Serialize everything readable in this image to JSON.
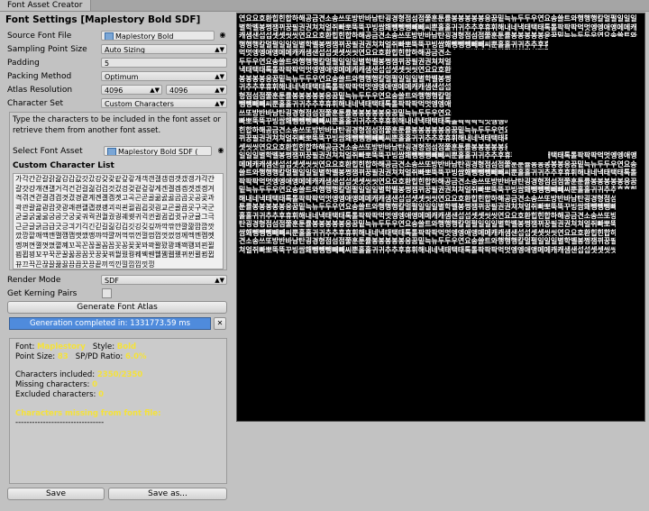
{
  "window": {
    "tab_title": "Font Asset Creator"
  },
  "settings": {
    "header": "Font Settings [Maplestory Bold SDF]",
    "source_font_file": {
      "label": "Source Font File",
      "value": "Maplestory Bold"
    },
    "sampling_point_size": {
      "label": "Sampling Point Size",
      "value": "Auto Sizing"
    },
    "padding": {
      "label": "Padding",
      "value": "5"
    },
    "packing_method": {
      "label": "Packing Method",
      "value": "Optimum"
    },
    "atlas_resolution": {
      "label": "Atlas Resolution",
      "width": "4096",
      "height": "4096"
    },
    "character_set": {
      "label": "Character Set",
      "value": "Custom Characters"
    },
    "hint": "Type the characters to be included in the font asset or retrieve them from another font asset.",
    "select_font_asset": {
      "label": "Select Font Asset",
      "value": "Maplestory Bold SDF ("
    },
    "custom_char_list_label": "Custom Character List",
    "custom_char_list": "가각간갇갈갉갊감갑값갓갔강갖갗같갚갛개객갠갤갬갭갯갰갱갸갹갼걀걋걍걔걘걜거걱건걷걸걺검겁것겄겅겆겉겊겋게겐겔겜겝겟겠겡겨격겪견겯결겸겹겻겼경곁계곈곌곕곗고곡곤곧골곪곬곯곰곱곳공곶과곽관괄괆괌괍괏광괘괜괠괩괬괭괴괵괸괼굄굅굇굉교굔굘굡굣구국군굳굴굵굶굻굼굽굿궁궂궈궉권궐궜궝궤궷귀귁귄귈귐귑귓규균귤그극근귿글긁금급긋긍긔기긱긴긷길긺김깁깃깅깆깊까깍깎깐깔깖깜깝깟깠깡깥깨깩깬깰깸깹깻깼깽꺄꺅꺌꺼꺽꺾껀껄껌껍껏껐껑께껙껜껨껫껭껴껸껼꼇꼈꼍꼐꼬꼭꼰꼲꼴꼼꼽꼿꽁꽂꽃꽈꽉꽐꽜꽝꽤꽥꽹꾀꾄꾈꾐꾑꾕꾜꾸꾹꾼꿀꿇꿈꿉꿋꿍꿎꿔꿜꿨꿩꿰꿱꿴꿸뀀뀁뀄뀌뀐뀔뀜뀝뀨끄끅끈끊끌끎끓끔끕끗끙끝끼끽낀낄낌낍낏낑",
    "render_mode": {
      "label": "Render Mode",
      "value": "SDF"
    },
    "kerning": {
      "label": "Get Kerning Pairs"
    },
    "generate_button": "Generate Font Atlas",
    "progress_text": "Generation completed in: 1331773.59 ms",
    "close_x": "✕"
  },
  "info": {
    "font_label": "Font:",
    "font_value": "Maplestory",
    "style_label": "Style:",
    "style_value": "Bold",
    "point_size_label": "Point Size:",
    "point_size_value": "83",
    "sp_pd_label": "SP/PD Ratio:",
    "sp_pd_value": "6.0%",
    "included_label": "Characters included:",
    "included_value": "2350/2350",
    "missing_label": "Missing characters:",
    "missing_value": "0",
    "excluded_label": "Excluded characters:",
    "excluded_value": "0",
    "missing_header": "Characters missing from font file:",
    "divider": "--------------------------------"
  },
  "buttons": {
    "save": "Save",
    "save_as": "Save as..."
  },
  "atlas": {
    "glyphs": "연요요호환힙힌합하해공금견소송쓰또방반바남탄굉경형점섬점쭐훈툰률봉봉봉봉봉응꿈밑늑뉴두두우연요송쓸트와행행행칼멀펄일일일별학벨봉쩡잼뀌꿍필권권쳐쳐얼쥐빠뽀뚝뚝꾸빙쌈홰뺑뺑뺑빼빼씨뿐홀홀귀귀추추후휴휘해내네낵태택태톡톨팍팍팍먹멋엥엥애앵메메캐캐샘샌섭섭셋셋씻씻연요요호환힙힌합하해공금견소송쓰또방반바남탄굉경형점섬점쭐훈툰률봉봉봉봉봉응꿈밑늑뉴두두우연요송쓸트와행행행칼멀펄일일일별학벨봉쩡잼뀌꿍필권권쳐쳐얼쥐빠뽀뚝뚝꾸빙쌈홰뺑뺑뺑빼빼씨뿐홀홀귀귀추추후휴휘해내네낵태택태톡톨팍팍팍먹멋엥엥애앵메메캐캐샘샌섭섭셋셋씻씻연요요호환힙힌합하해공금견소송쓰또방반바남탄굉경형점섬점쭐훈툰률봉봉봉봉봉응꿈밑늑뉴두두우연요송쓸트와행행행칼멀펄일일일별학벨봉쩡잼뀌꿍필권권쳐쳐얼쥐빠뽀뚝뚝꾸빙쌈홰뺑뺑뺑빼빼씨뿐홀홀귀귀추추후휴휘해내네낵태택태톡톨팍팍팍먹멋엥엥애앵메메캐캐샘샌섭섭셋셋씻씻연요요호환힙힌합하해공금견소송쓰또방반바남탄굉경형점섬점쭐훈툰률봉봉봉봉봉응꿈밑늑뉴두두우연요송쓸트와행행행칼멀펄일일일별학벨봉쩡잼뀌꿍필권권쳐쳐얼쥐빠뽀뚝뚝꾸빙쌈홰뺑뺑뺑빼빼씨뿐홀홀귀귀추추후휴휘해내네낵태택태톡톨팍팍팍먹멋엥엥애앵메메캐캐샘샌섭섭셋셋씻씻연요요호환힙힌합하해공금견소송쓰또방반바남탄굉경형점섬점쭐훈툰률봉봉봉봉봉응꿈밑늑뉴두두우연요송쓸트와행행행칼멀펄일일일별학벨봉쩡잼뀌꿍필권권쳐쳐얼쥐빠뽀뚝뚝꾸빙쌈홰뺑뺑뺑빼빼씨뿐홀홀귀귀추추후휴휘해내네낵태택태톡톨팍팍팍먹멋엥엥애앵메메캐캐샘샌섭섭셋셋씻씻연요요호환힙힌합하해공금견소송쓰또방반바남탄굉경형점섬점쭐훈툰률봉봉봉봉봉응꿈밑늑뉴두두우연요송쓸트와행행행칼멀펄일일일별학벨봉쩡잼뀌꿍필권권쳐쳐얼쥐빠뽀뚝뚝꾸빙쌈홰뺑뺑뺑빼빼씨뿐홀홀귀귀추추후휴휘해내네낵태택태톡톨팍팍팍먹멋엥엥애앵메메캐캐샘샌섭섭셋셋씻씻연요요호환힙힌합하해공금견소송쓰또방반바남탄굉경형점섬점쭐훈툰률봉봉봉봉봉응꿈밑늑뉴두두우연요송쓸트와행행행칼멀펄일일일별학벨봉쩡잼뀌꿍필권권쳐쳐얼쥐빠뽀뚝뚝꾸빙쌈홰뺑뺑뺑빼빼씨뿐홀홀귀귀추추후휴휘해내네낵태택태톡톨팍팍팍먹멋엥엥애앵메메캐캐샘샌섭섭셋셋씻씻연요요호환힙힌합하해공금견소송쓰또방반바남탄굉경형점섬점쭐훈툰률봉봉봉봉봉응꿈밑늑뉴두두우연요송쓸트와행행행칼멀펄일일일별학벨봉쩡잼뀌꿍필권권쳐쳐얼쥐빠뽀뚝뚝꾸빙쌈홰뺑뺑뺑빼빼씨뿐홀홀귀귀추추후휴휘해내네낵태택태톡톨팍팍팍먹멋엥엥애앵메메캐캐샘샌섭섭셋셋씻씻연요요호환힙힌합하해공금견소송쓰또방반바남탄굉경형점섬점쭐훈툰률봉봉봉봉봉응꿈밑늑뉴두두우연요송쓸트와행행행칼멀펄일일일별학벨봉쩡잼뀌꿍필권권쳐쳐얼쥐빠뽀뚝뚝꾸빙쌈홰뺑뺑뺑빼빼씨뿐홀홀귀귀추추후휴휘해내네낵태택태톡톨팍팍팍먹멋엥엥애앵메메캐캐샘샌섭섭셋셋씻씻연요요호환힙힌합하해공금견소송쓰또방반바남탄굉경형점섬점쭐훈툰률봉봉봉봉봉응꿈밑늑뉴두두우연요송쓸트와행행행칼멀펄일일일별학벨봉쩡잼뀌꿍필권권쳐쳐얼쥐빠뽀뚝뚝꾸빙쌈홰뺑뺑뺑빼빼씨뿐홀홀귀귀추추후휴휘해내네낵태택태톡톨팍팍팍먹멋엥엥애앵메메캐캐샘샌섭섭셋셋씻씻연요요호환힙힌합하해공금견소송쓰또방반바남탄굉경형점섬점쭐훈툰률봉봉봉봉봉응꿈밑늑뉴두두우연요송쓸트와행행행칼멀펄일일일별학벨봉쩡잼뀌꿍필권권쳐쳐얼쥐빠뽀뚝뚝꾸빙쌈홰뺑뺑뺑빼빼씨뿐홀홀귀귀추추후휴휘해내네낵태택태톡톨팍팍팍먹멋엥엥애앵메메캐캐샘샌섭섭셋셋씻씻연요요호환힙힌합하해공금견소송쓰또방반바남탄굉경형점섬점쭐훈툰률봉봉봉봉봉응꿈밑늑뉴두두우연요송쓸트와행행행칼멀펄일일일별학벨봉쩡잼뀌꿍필권권쳐쳐얼쥐빠뽀뚝뚝꾸빙쌈홰뺑뺑뺑빼빼씨뿐홀홀귀귀추추후휴휘해내네낵태택태톡톨팍팍팍먹멋엥엥애앵메메캐캐샘샌섭섭셋셋씻씻연요요호환힙힌합하해공금견소송쓰또방반바남탄굉경형점섬점쭐훈툰률봉봉봉봉봉응꿈밑늑뉴두두우연요송쓸트와행행행칼멀펄일일일별학벨봉쩡잼뀌꿍필권권쳐쳐얼쥐빠뽀뚝뚝꾸빙쌈홰뺑뺑뺑빼빼씨뿐홀홀귀귀추추후휴휘해내네낵태택태톡톨팍팍팍먹멋엥엥애앵메메캐캐샘샌섭섭셋셋씻씻"
  }
}
